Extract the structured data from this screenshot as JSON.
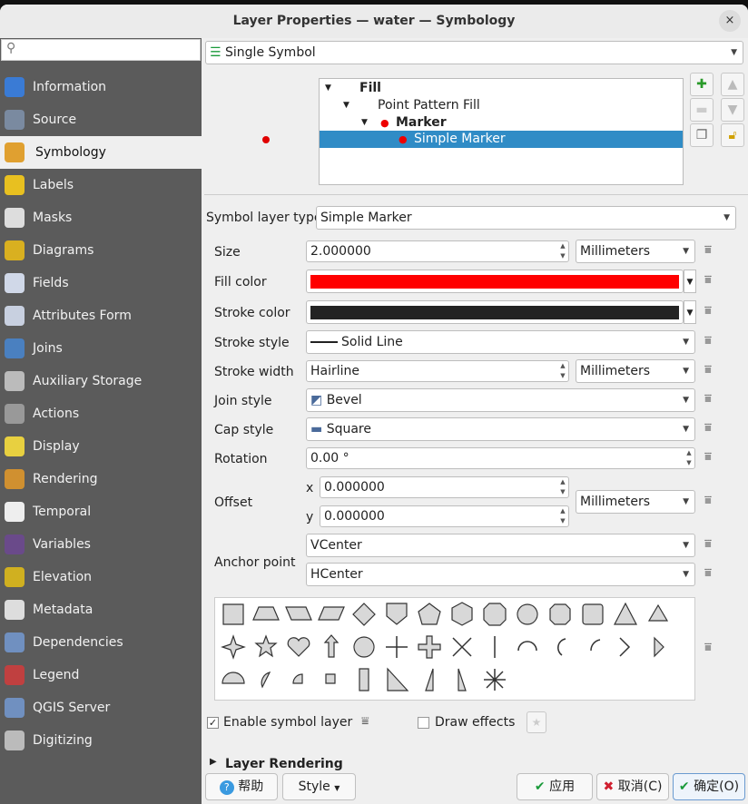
{
  "window": {
    "title": "Layer Properties — water — Symbology",
    "close_label": "×"
  },
  "sidebar": {
    "search_placeholder": "",
    "items": [
      {
        "label": "Information",
        "icon": "info-icon",
        "color": "#3a7bd5"
      },
      {
        "label": "Source",
        "icon": "source-tools-icon",
        "color": "#7a8aa0"
      },
      {
        "label": "Symbology",
        "icon": "paintbrush-icon",
        "color": "#e0a030"
      },
      {
        "label": "Labels",
        "icon": "labels-abc-icon",
        "color": "#e8c020"
      },
      {
        "label": "Masks",
        "icon": "masks-abc-icon",
        "color": "#ddd"
      },
      {
        "label": "Diagrams",
        "icon": "diagrams-icon",
        "color": "#d9b020"
      },
      {
        "label": "Fields",
        "icon": "fields-icon",
        "color": "#d0d8e8"
      },
      {
        "label": "Attributes Form",
        "icon": "attributes-form-icon",
        "color": "#c8d0e0"
      },
      {
        "label": "Joins",
        "icon": "joins-icon",
        "color": "#4a80c0"
      },
      {
        "label": "Auxiliary Storage",
        "icon": "database-icon",
        "color": "#bbb"
      },
      {
        "label": "Actions",
        "icon": "actions-gear-icon",
        "color": "#999"
      },
      {
        "label": "Display",
        "icon": "display-speech-icon",
        "color": "#e8d040"
      },
      {
        "label": "Rendering",
        "icon": "rendering-brush-icon",
        "color": "#d09030"
      },
      {
        "label": "Temporal",
        "icon": "clock-icon",
        "color": "#eee"
      },
      {
        "label": "Variables",
        "icon": "variables-epsilon-icon",
        "color": "#6a4a8a"
      },
      {
        "label": "Elevation",
        "icon": "elevation-icon",
        "color": "#d0b020"
      },
      {
        "label": "Metadata",
        "icon": "metadata-icon",
        "color": "#ddd"
      },
      {
        "label": "Dependencies",
        "icon": "dependencies-icon",
        "color": "#7090c0"
      },
      {
        "label": "Legend",
        "icon": "legend-icon",
        "color": "#c04040"
      },
      {
        "label": "QGIS Server",
        "icon": "server-icon",
        "color": "#7090c0"
      },
      {
        "label": "Digitizing",
        "icon": "digitizing-icon",
        "color": "#bbb"
      }
    ],
    "selected": "Symbology"
  },
  "renderer": {
    "value": "Single Symbol"
  },
  "tree": {
    "nodes": [
      {
        "label": "Fill",
        "bold": true
      },
      {
        "label": "Point Pattern Fill",
        "bold": false
      },
      {
        "label": "Marker",
        "bold": true
      },
      {
        "label": "Simple Marker",
        "bold": false,
        "selected": true
      }
    ]
  },
  "form": {
    "symbol_layer_type_label": "Symbol layer type",
    "symbol_layer_type": "Simple Marker",
    "size_label": "Size",
    "size": "2.000000",
    "size_unit": "Millimeters",
    "fill_color_label": "Fill color",
    "fill_color": "#ff0000",
    "stroke_color_label": "Stroke color",
    "stroke_color": "#232323",
    "stroke_style_label": "Stroke style",
    "stroke_style": "Solid Line",
    "stroke_width_label": "Stroke width",
    "stroke_width": "Hairline",
    "stroke_width_unit": "Millimeters",
    "join_style_label": "Join style",
    "join_style": "Bevel",
    "cap_style_label": "Cap style",
    "cap_style": "Square",
    "rotation_label": "Rotation",
    "rotation": "0.00 °",
    "offset_label": "Offset",
    "offset_x_label": "x",
    "offset_x": "0.000000",
    "offset_y_label": "y",
    "offset_y": "0.000000",
    "offset_unit": "Millimeters",
    "anchor_label": "Anchor point",
    "anchor_v": "VCenter",
    "anchor_h": "HCenter"
  },
  "options": {
    "enable_label": "Enable symbol layer",
    "enable_checked": true,
    "effects_label": "Draw effects",
    "effects_checked": false
  },
  "layer_rendering": "Layer Rendering",
  "buttons": {
    "help": "帮助",
    "style": "Style",
    "apply": "应用",
    "cancel": "取消(C)",
    "ok": "确定(O)"
  }
}
